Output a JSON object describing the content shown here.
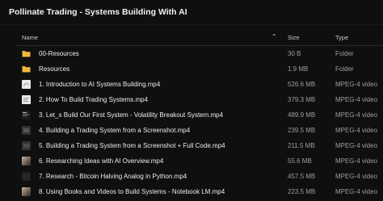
{
  "page": {
    "title": "Pollinate Trading - Systems Building With AI"
  },
  "columns": {
    "name": "Name",
    "size": "Size",
    "type": "Type",
    "sort_indicator": "⌃"
  },
  "rows": [
    {
      "name": "00-Resources",
      "size": "30 B",
      "type": "Folder",
      "icon": "folder-icon"
    },
    {
      "name": "Resources",
      "size": "1.9 MB",
      "type": "Folder",
      "icon": "folder-icon"
    },
    {
      "name": "1. Introduction to AI Systems Building.mp4",
      "size": "526.6 MB",
      "type": "MPEG-4 video",
      "icon": "video-thumbnail-icon"
    },
    {
      "name": "2. How To Build Trading Systems.mp4",
      "size": "379.3 MB",
      "type": "MPEG-4 video",
      "icon": "video-thumbnail-icon"
    },
    {
      "name": "3. Let_s Build Our First System - Volatility Breakout System.mp4",
      "size": "489.9 MB",
      "type": "MPEG-4 video",
      "icon": "video-thumbnail-icon"
    },
    {
      "name": "4. Building a Trading System from a Screenshot.mp4",
      "size": "239.5 MB",
      "type": "MPEG-4 video",
      "icon": "video-thumbnail-icon"
    },
    {
      "name": "5. Building a Trading System from a Screenshot + Full Code.mp4",
      "size": "211.5 MB",
      "type": "MPEG-4 video",
      "icon": "video-thumbnail-icon"
    },
    {
      "name": "6. Researching Ideas with AI Overview.mp4",
      "size": "55.6 MB",
      "type": "MPEG-4 video",
      "icon": "video-thumbnail-icon"
    },
    {
      "name": "7. Research - Bitcoin Halving Analog in Python.mp4",
      "size": "457.5 MB",
      "type": "MPEG-4 video",
      "icon": "video-thumbnail-icon"
    },
    {
      "name": "8. Using Books and Videos to Build Systems - Notebook LM.mp4",
      "size": "223.5 MB",
      "type": "MPEG-4 video",
      "icon": "video-thumbnail-icon"
    }
  ],
  "colors": {
    "folder": "#f2b63c",
    "background": "#0f0f0f"
  }
}
